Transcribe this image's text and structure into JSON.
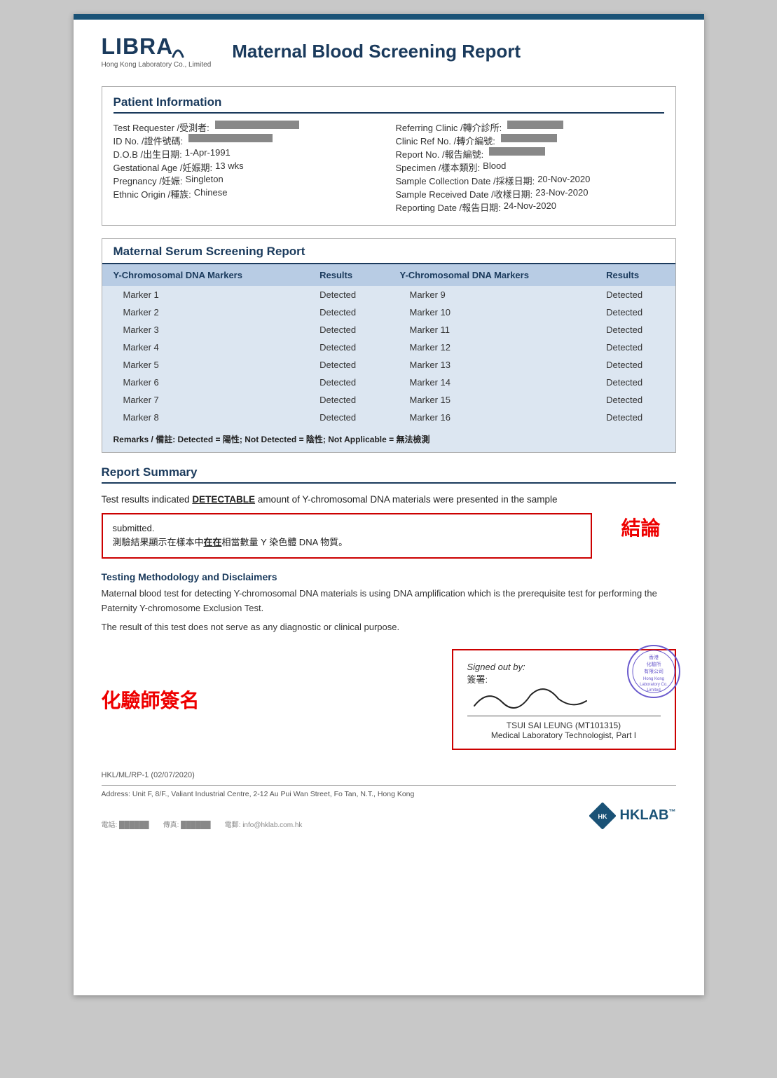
{
  "header": {
    "logo_name": "LIBRA",
    "logo_subtitle": "Hong Kong Laboratory Co., Limited",
    "report_title": "Maternal Blood Screening Report"
  },
  "patient_info": {
    "section_title": "Patient Information",
    "left_fields": [
      {
        "label": "Test Requester /受測者:",
        "value": "REDACTED"
      },
      {
        "label": "ID No. /證件號碼:",
        "value": "REDACTED"
      },
      {
        "label": "D.O.B /出生日期:",
        "value": "1-Apr-1991"
      },
      {
        "label": "Gestational Age /妊娠期:",
        "value": "13 wks"
      },
      {
        "label": "Pregnancy /妊娠:",
        "value": "Singleton"
      },
      {
        "label": "Ethnic Origin /種族:",
        "value": "Chinese"
      }
    ],
    "right_fields": [
      {
        "label": "Referring Clinic /轉介診所:",
        "value": "REDACTED"
      },
      {
        "label": "Clinic Ref No. /轉介編號:",
        "value": "REDACTED"
      },
      {
        "label": "Report No. /報告編號:",
        "value": "REDACTED"
      },
      {
        "label": "Specimen /樣本類別:",
        "value": "Blood"
      },
      {
        "label": "Sample Collection Date /採樣日期:",
        "value": "20-Nov-2020"
      },
      {
        "label": "Sample Received Date /收樣日期:",
        "value": "23-Nov-2020"
      },
      {
        "label": "Reporting Date /報告日期:",
        "value": "24-Nov-2020"
      }
    ]
  },
  "serum_section": {
    "section_title": "Maternal Serum Screening Report",
    "col1_header": "Y-Chromosomal DNA Markers",
    "col2_header": "Results",
    "col3_header": "Y-Chromosomal DNA Markers",
    "col4_header": "Results",
    "left_markers": [
      {
        "marker": "Marker 1",
        "result": "Detected"
      },
      {
        "marker": "Marker 2",
        "result": "Detected"
      },
      {
        "marker": "Marker 3",
        "result": "Detected"
      },
      {
        "marker": "Marker 4",
        "result": "Detected"
      },
      {
        "marker": "Marker 5",
        "result": "Detected"
      },
      {
        "marker": "Marker 6",
        "result": "Detected"
      },
      {
        "marker": "Marker 7",
        "result": "Detected"
      },
      {
        "marker": "Marker 8",
        "result": "Detected"
      }
    ],
    "right_markers": [
      {
        "marker": "Marker 9",
        "result": "Detected"
      },
      {
        "marker": "Marker 10",
        "result": "Detected"
      },
      {
        "marker": "Marker 11",
        "result": "Detected"
      },
      {
        "marker": "Marker 12",
        "result": "Detected"
      },
      {
        "marker": "Marker 13",
        "result": "Detected"
      },
      {
        "marker": "Marker 14",
        "result": "Detected"
      },
      {
        "marker": "Marker 15",
        "result": "Detected"
      },
      {
        "marker": "Marker 16",
        "result": "Detected"
      }
    ],
    "remarks": "Remarks / 備註: Detected = 陽性; Not Detected = 陰性; Not Applicable = 無法檢測"
  },
  "report_summary": {
    "section_title": "Report Summary",
    "summary_line1": "Test results indicated ",
    "summary_highlight": "DETECTABLE",
    "summary_line2": " amount of Y-chromosomal DNA materials were presented in the sample",
    "summary_line3": "submitted.",
    "chinese_text_prefix": "測驗結果顯示在樣本中",
    "chinese_underline": "在在",
    "chinese_text_suffix": "相當數量 Y 染色體 DNA 物質。",
    "conclusion_label": "結論"
  },
  "methodology": {
    "title": "Testing Methodology and Disclaimers",
    "text1": "Maternal blood test for detecting Y-chromosomal DNA materials is using DNA amplification which is the prerequisite test for performing the Paternity Y-chromosome Exclusion Test.",
    "text2": "The result of this test does not serve as any diagnostic or clinical purpose."
  },
  "signature": {
    "chemist_label": "化驗師簽名",
    "signed_by_en": "Signed out by:",
    "signed_by_cn": "簽署:",
    "signee_name": "TSUI SAI LEUNG (MT101315)",
    "signee_title": "Medical Laboratory Technologist, Part I",
    "stamp_text": "香港\n化驗所\n有限公司\nHong Kong\nLaboratory Co.\nLimited"
  },
  "footer": {
    "ref": "HKL/ML/RP-1 (02/07/2020)",
    "address": "Address: Unit F, 8/F., Valiant Industrial Centre, 2-12 Au Pui Wan Street, Fo Tan, N.T., Hong Kong",
    "contacts": [
      "電話:",
      "傳真:",
      "電郵: info@hklab.com.hk"
    ],
    "hklab_label": "HKLAB™"
  }
}
